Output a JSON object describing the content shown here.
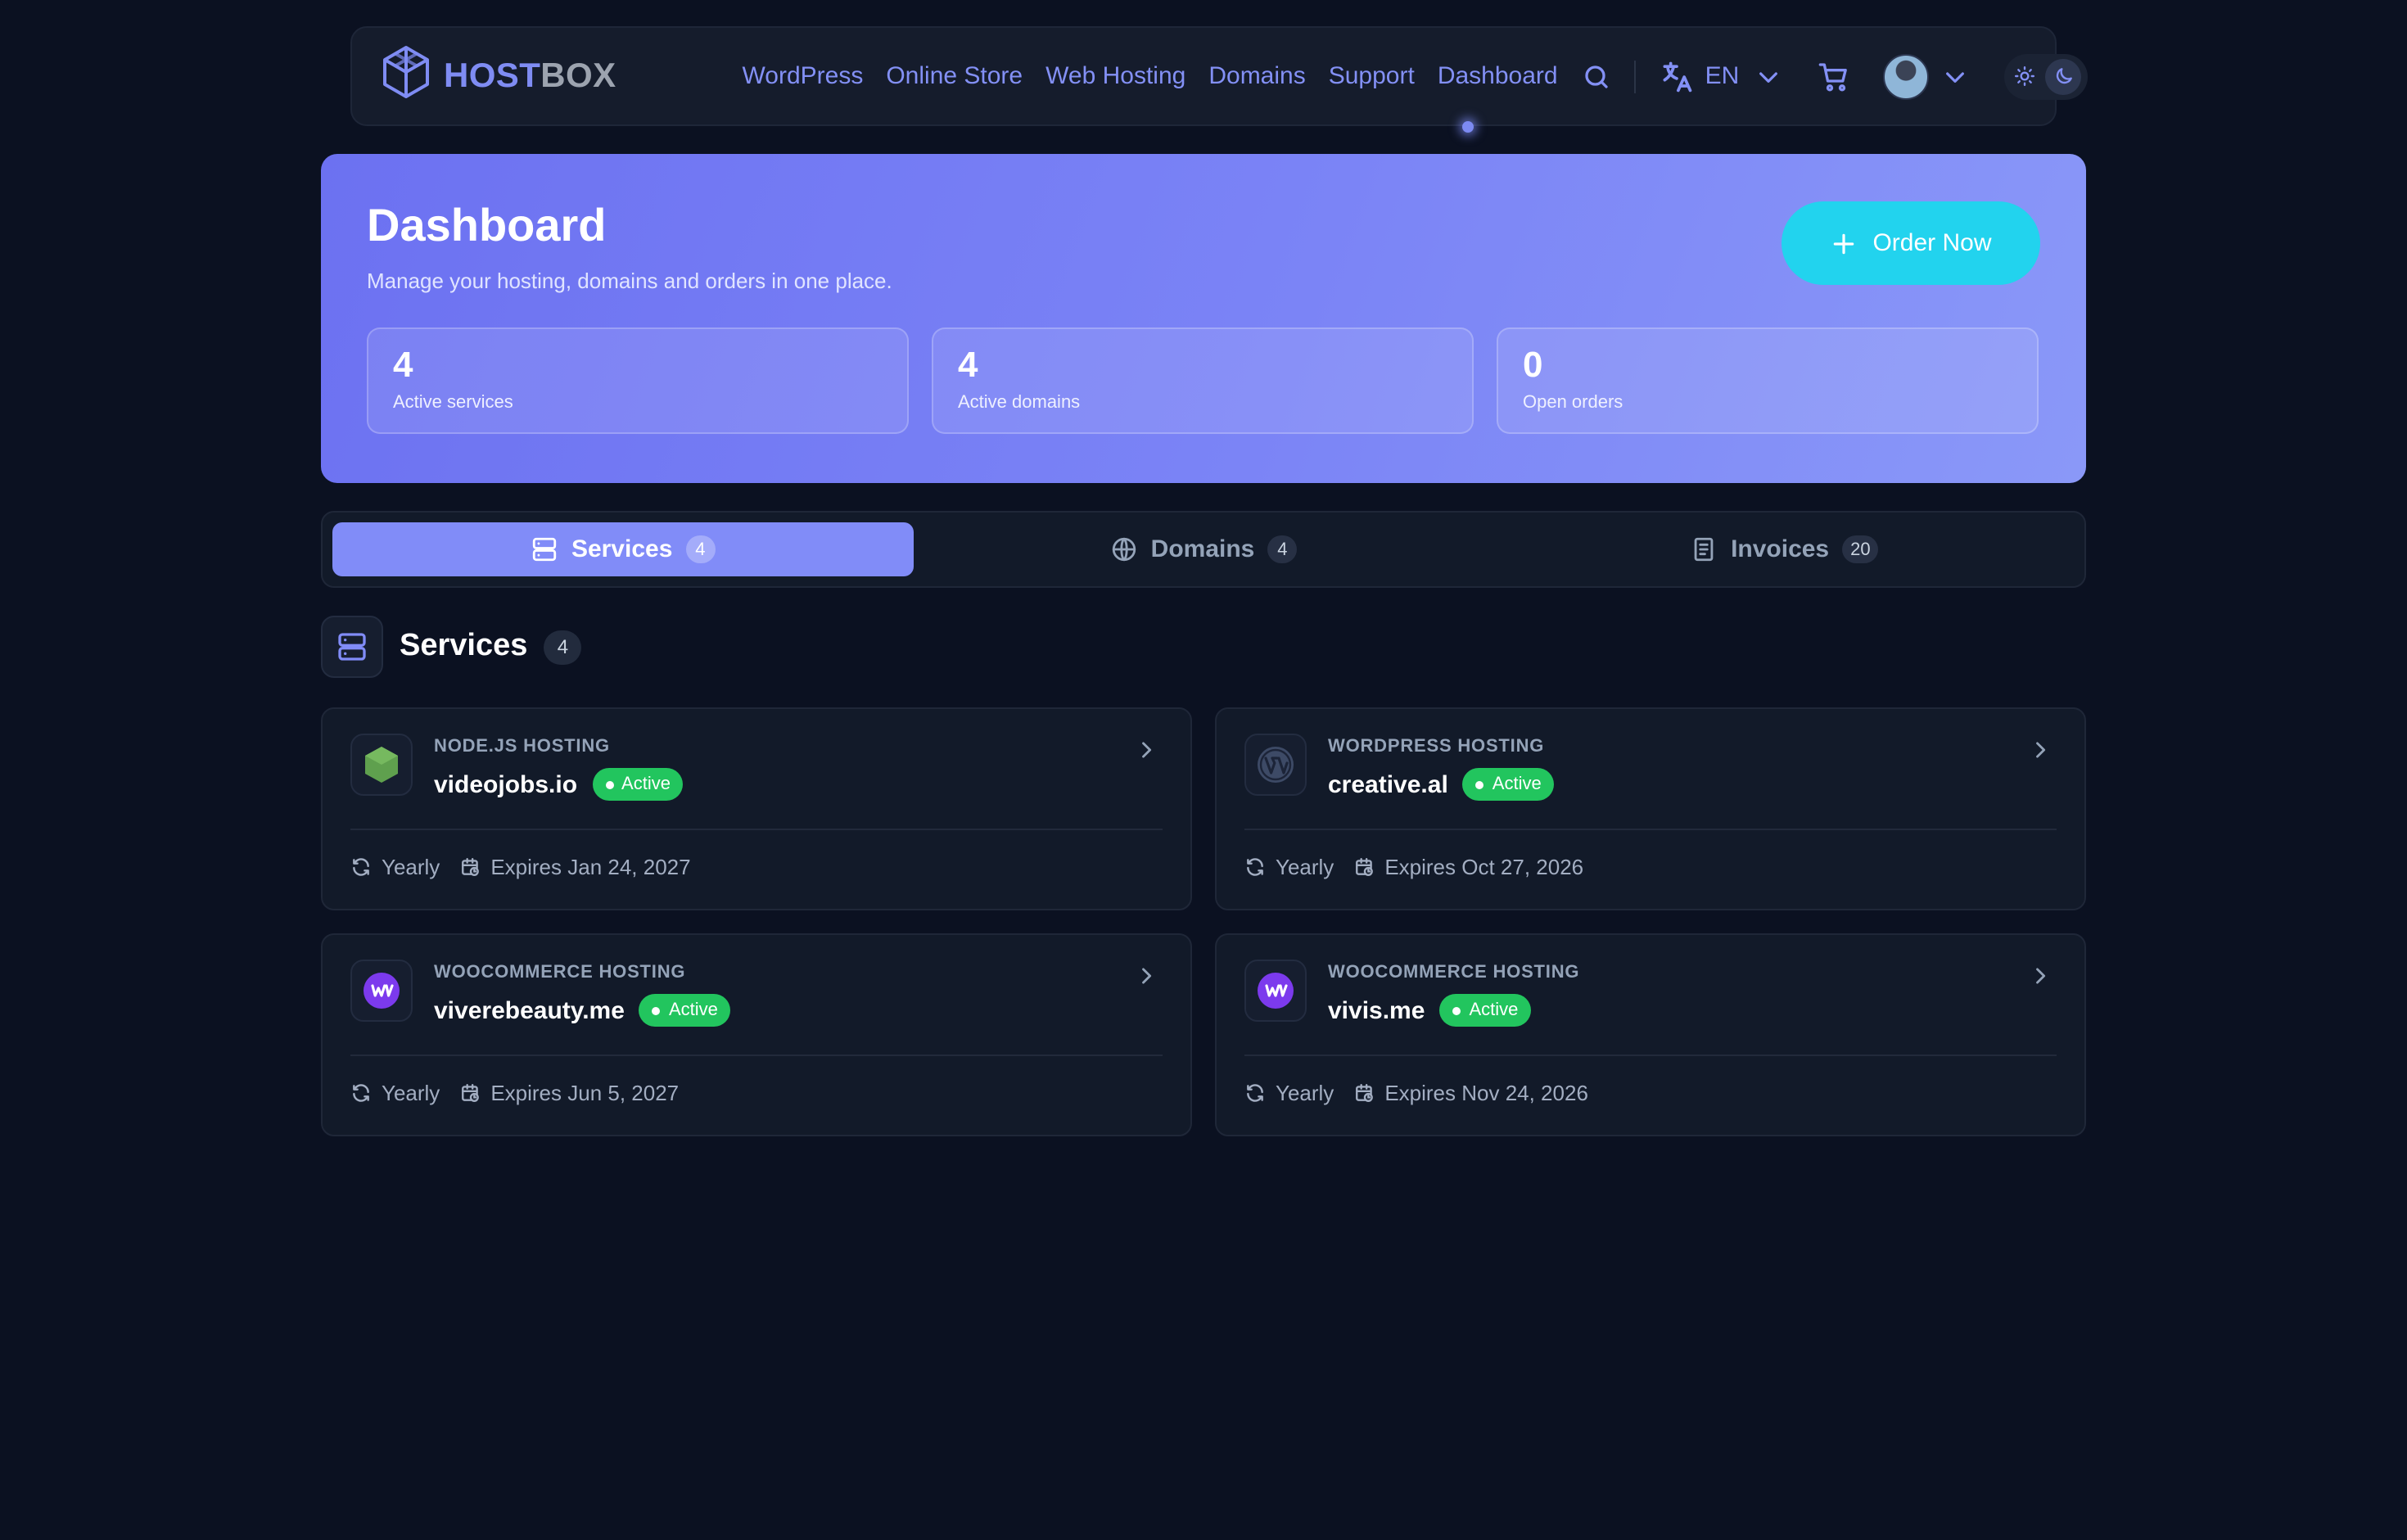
{
  "brand": {
    "name_part1": "HOST",
    "name_part2": "BOX"
  },
  "nav": {
    "links": [
      "WordPress",
      "Online Store",
      "Web Hosting",
      "Domains",
      "Support",
      "Dashboard"
    ],
    "active": "Dashboard",
    "language": "EN"
  },
  "hero": {
    "title": "Dashboard",
    "subtitle": "Manage your hosting, domains and orders in one place.",
    "order_button": "Order Now",
    "stats": [
      {
        "value": "4",
        "label": "Active services"
      },
      {
        "value": "4",
        "label": "Active domains"
      },
      {
        "value": "0",
        "label": "Open orders"
      }
    ]
  },
  "tabs": [
    {
      "label": "Services",
      "count": "4",
      "icon": "server-icon",
      "active": true
    },
    {
      "label": "Domains",
      "count": "4",
      "icon": "globe-icon",
      "active": false
    },
    {
      "label": "Invoices",
      "count": "20",
      "icon": "document-icon",
      "active": false
    }
  ],
  "section": {
    "title": "Services",
    "count": "4"
  },
  "services": [
    {
      "type": "NODE.JS HOSTING",
      "name": "videojobs.io",
      "status": "Active",
      "cycle": "Yearly",
      "expires": "Expires Jan 24, 2027",
      "icon": "nodejs-icon"
    },
    {
      "type": "WORDPRESS HOSTING",
      "name": "creative.al",
      "status": "Active",
      "cycle": "Yearly",
      "expires": "Expires Oct 27, 2026",
      "icon": "wordpress-icon"
    },
    {
      "type": "WOOCOMMERCE HOSTING",
      "name": "viverebeauty.me",
      "status": "Active",
      "cycle": "Yearly",
      "expires": "Expires Jun 5, 2027",
      "icon": "woocommerce-icon"
    },
    {
      "type": "WOOCOMMERCE HOSTING",
      "name": "vivis.me",
      "status": "Active",
      "cycle": "Yearly",
      "expires": "Expires Nov 24, 2026",
      "icon": "woocommerce-icon"
    }
  ],
  "colors": {
    "background": "#0b1121",
    "accent": "#818cf8",
    "order_button": "#22d3ee",
    "status_active": "#22c55e"
  }
}
